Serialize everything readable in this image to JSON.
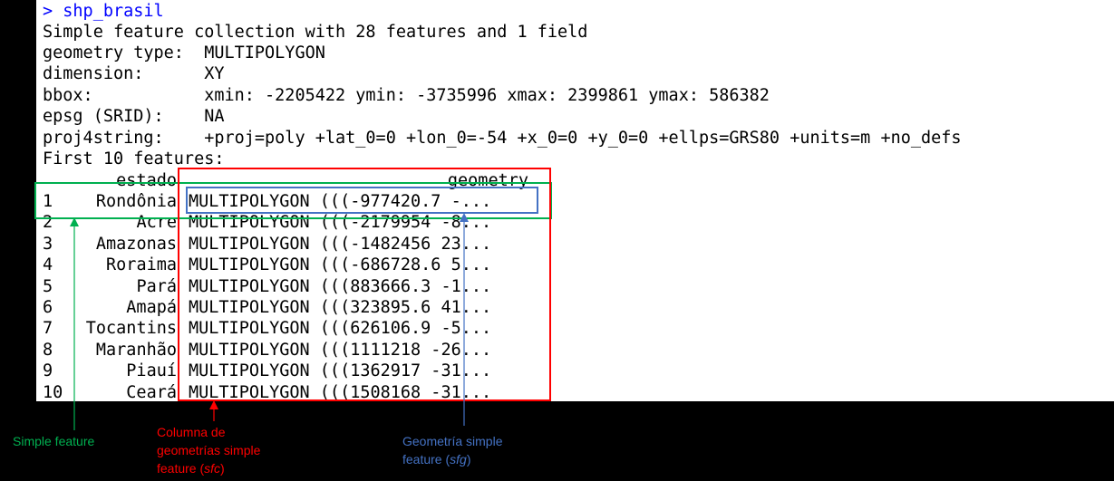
{
  "console": {
    "prompt": "> shp_brasil",
    "lines": [
      "Simple feature collection with 28 features and 1 field",
      "geometry type:  MULTIPOLYGON",
      "dimension:      XY",
      "bbox:           xmin: -2205422 ymin: -3735996 xmax: 2399861 ymax: 586382",
      "epsg (SRID):    NA",
      "proj4string:    +proj=poly +lat_0=0 +lon_0=-54 +x_0=0 +y_0=0 +ellps=GRS80 +units=m +no_defs",
      "First 10 features:"
    ],
    "table": {
      "headers": [
        "estado",
        "geometry"
      ],
      "rows": [
        {
          "idx": "1",
          "estado": "Rondônia",
          "geometry": "MULTIPOLYGON (((-977420.7 -..."
        },
        {
          "idx": "2",
          "estado": "Acre",
          "geometry": "MULTIPOLYGON (((-2179954 -8..."
        },
        {
          "idx": "3",
          "estado": "Amazonas",
          "geometry": "MULTIPOLYGON (((-1482456 23..."
        },
        {
          "idx": "4",
          "estado": "Roraima",
          "geometry": "MULTIPOLYGON (((-686728.6 5..."
        },
        {
          "idx": "5",
          "estado": "Pará",
          "geometry": "MULTIPOLYGON (((883666.3 -1..."
        },
        {
          "idx": "6",
          "estado": "Amapá",
          "geometry": "MULTIPOLYGON (((323895.6 41..."
        },
        {
          "idx": "7",
          "estado": "Tocantins",
          "geometry": "MULTIPOLYGON (((626106.9 -5..."
        },
        {
          "idx": "8",
          "estado": "Maranhão",
          "geometry": "MULTIPOLYGON (((1111218 -26..."
        },
        {
          "idx": "9",
          "estado": "Piauí",
          "geometry": "MULTIPOLYGON (((1362917 -31..."
        },
        {
          "idx": "10",
          "estado": "Ceará",
          "geometry": "MULTIPOLYGON (((1508168 -31..."
        }
      ]
    }
  },
  "annotations": {
    "simple_feature": "Simple feature",
    "sfc_lines": [
      "Columna de",
      "geometrías simple"
    ],
    "sfc_last_prefix": "feature (",
    "sfc_abbr": "sfc",
    "sfc_suffix": ")",
    "sfg_line1": "Geometría simple",
    "sfg_prefix": "feature (",
    "sfg_abbr": "sfg",
    "sfg_suffix": ")"
  },
  "colors": {
    "simple_feature": "#00b050",
    "sfc": "#ff0000",
    "sfg": "#4472c4",
    "prompt": "#0000ff"
  }
}
